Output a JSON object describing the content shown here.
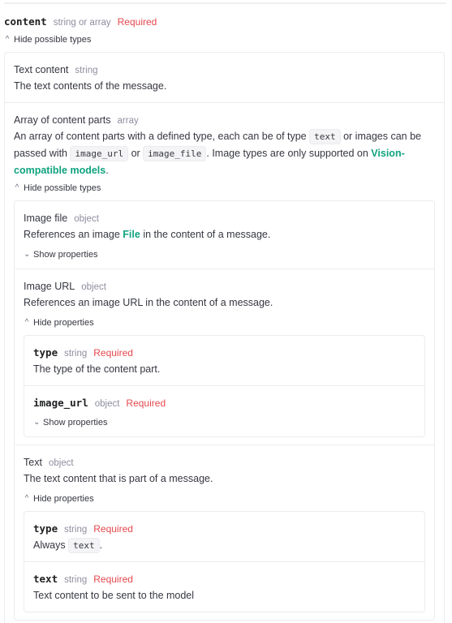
{
  "param": {
    "name": "content",
    "type": "string or array",
    "required": "Required",
    "toggle": "Hide possible types",
    "variants": [
      {
        "title": "Text content",
        "type": "string",
        "desc": "The text contents of the message."
      },
      {
        "title": "Array of content parts",
        "type": "array",
        "desc_parts": {
          "a": "An array of content parts with a defined type, each can be of type ",
          "code1": "text",
          "b": " or images can be passed with ",
          "code2": "image_url",
          "c": " or ",
          "code3": "image_file",
          "d": ". Image types are only supported on ",
          "link": "Vision-compatible models",
          "e": "."
        },
        "toggle": "Hide possible types",
        "subtypes": [
          {
            "title": "Image file",
            "type": "object",
            "desc_a": "References an image ",
            "desc_link": "File",
            "desc_b": " in the content of a message.",
            "toggle": "Show properties"
          },
          {
            "title": "Image URL",
            "type": "object",
            "desc": "References an image URL in the content of a message.",
            "toggle": "Hide properties",
            "props": [
              {
                "name": "type",
                "type": "string",
                "required": "Required",
                "desc": "The type of the content part."
              },
              {
                "name": "image_url",
                "type": "object",
                "required": "Required",
                "toggle": "Show properties"
              }
            ]
          },
          {
            "title": "Text",
            "type": "object",
            "desc": "The text content that is part of a message.",
            "toggle": "Hide properties",
            "props": [
              {
                "name": "type",
                "type": "string",
                "required": "Required",
                "desc_a": "Always ",
                "desc_code": "text",
                "desc_b": "."
              },
              {
                "name": "text",
                "type": "string",
                "required": "Required",
                "desc": "Text content to be sent to the model"
              }
            ]
          }
        ]
      }
    ]
  },
  "colors": {
    "required": "#e5484d",
    "link": "#10a37f",
    "muted": "#8e8ea0"
  }
}
